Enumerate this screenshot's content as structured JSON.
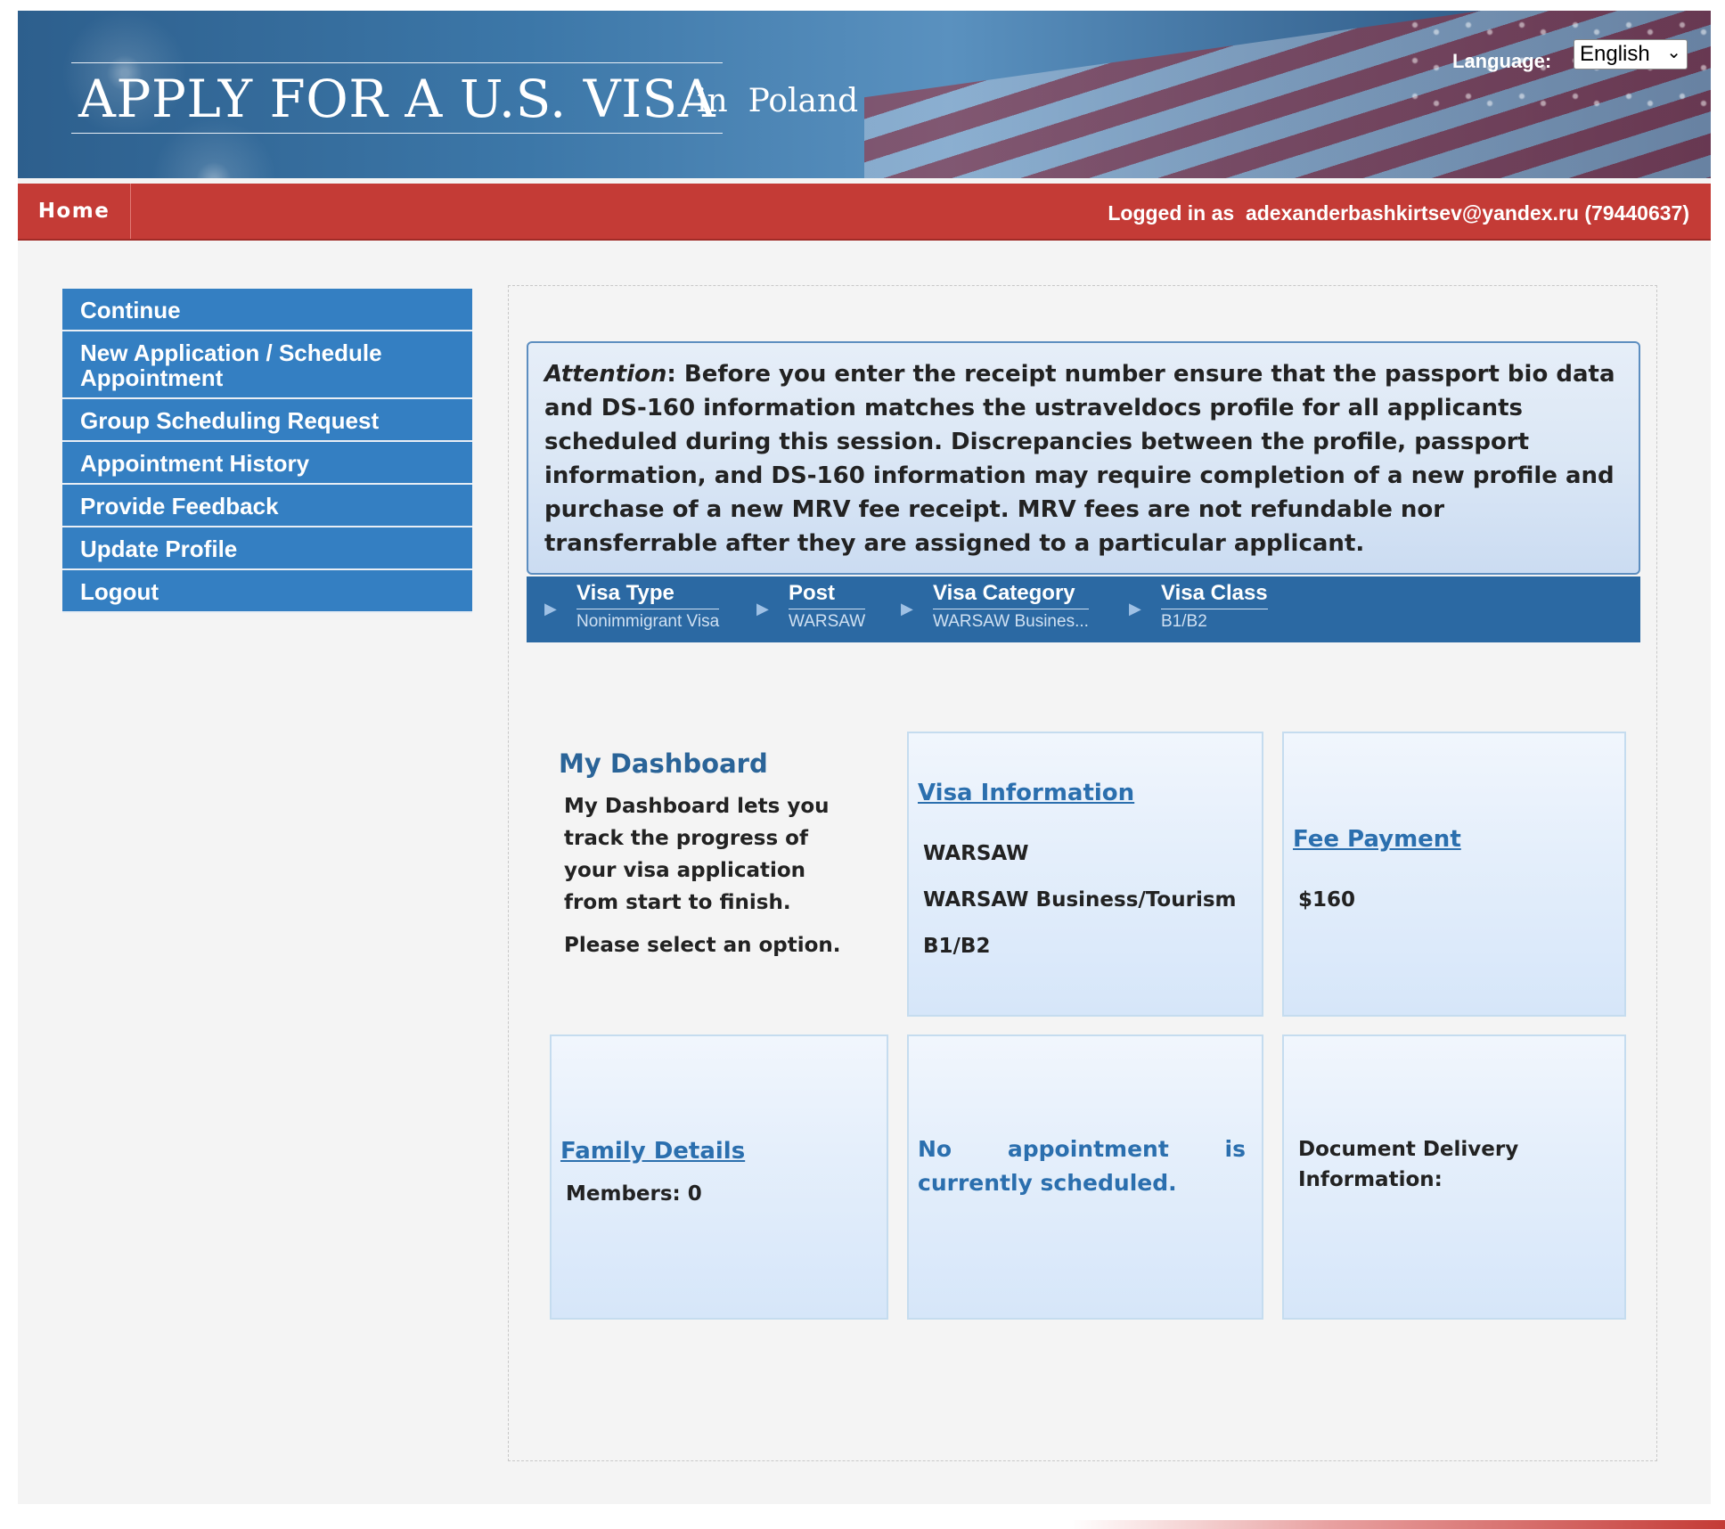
{
  "header": {
    "title": "APPLY FOR A U.S. VISA",
    "subtitle": "in  Poland",
    "language_label": "Language:",
    "language_value": "English"
  },
  "nav": {
    "home": "Home",
    "logged_in_as": "Logged in as  adexanderbashkirtsev@yandex.ru (79440637)"
  },
  "sidebar": {
    "items": [
      {
        "label": "Continue"
      },
      {
        "label": "New Application / Schedule Appointment"
      },
      {
        "label": "Group Scheduling Request"
      },
      {
        "label": "Appointment History"
      },
      {
        "label": "Provide Feedback"
      },
      {
        "label": "Update Profile"
      },
      {
        "label": "Logout"
      }
    ]
  },
  "attention": {
    "label": "Attention",
    "text": ": Before you enter the receipt number ensure that the passport bio data and DS-160 information matches the ustraveldocs profile for all applicants scheduled during this session. Discrepancies between the profile, passport information, and DS-160 information may require completion of a new profile and purchase of a new MRV fee receipt. MRV fees are not refundable nor transferrable after they are assigned to a particular applicant."
  },
  "breadcrumb": {
    "items": [
      {
        "title": "Visa Type",
        "value": "Nonimmigrant Visa"
      },
      {
        "title": "Post",
        "value": "WARSAW"
      },
      {
        "title": "Visa Category",
        "value": "WARSAW Busines..."
      },
      {
        "title": "Visa Class",
        "value": "B1/B2"
      }
    ]
  },
  "dashboard": {
    "title": "My Dashboard",
    "description": "My Dashboard lets you track the progress of your visa application from start to finish.",
    "prompt": "Please select an option."
  },
  "cards": {
    "visa_info": {
      "link": "Visa Information",
      "post": "WARSAW",
      "category": "WARSAW Business/Tourism",
      "class": "B1/B2"
    },
    "fee_payment": {
      "link": "Fee Payment",
      "amount": "$160"
    },
    "family": {
      "link": "Family Details",
      "members": "Members: 0"
    },
    "appointment": {
      "text": "No appointment is currently scheduled."
    },
    "delivery": {
      "text": "Document Delivery Information:"
    }
  },
  "colors": {
    "nav_red": "#c43b36",
    "sidebar_blue": "#347fc2",
    "breadcrumb_blue": "#2b69a3",
    "link_blue": "#2b6fae"
  }
}
